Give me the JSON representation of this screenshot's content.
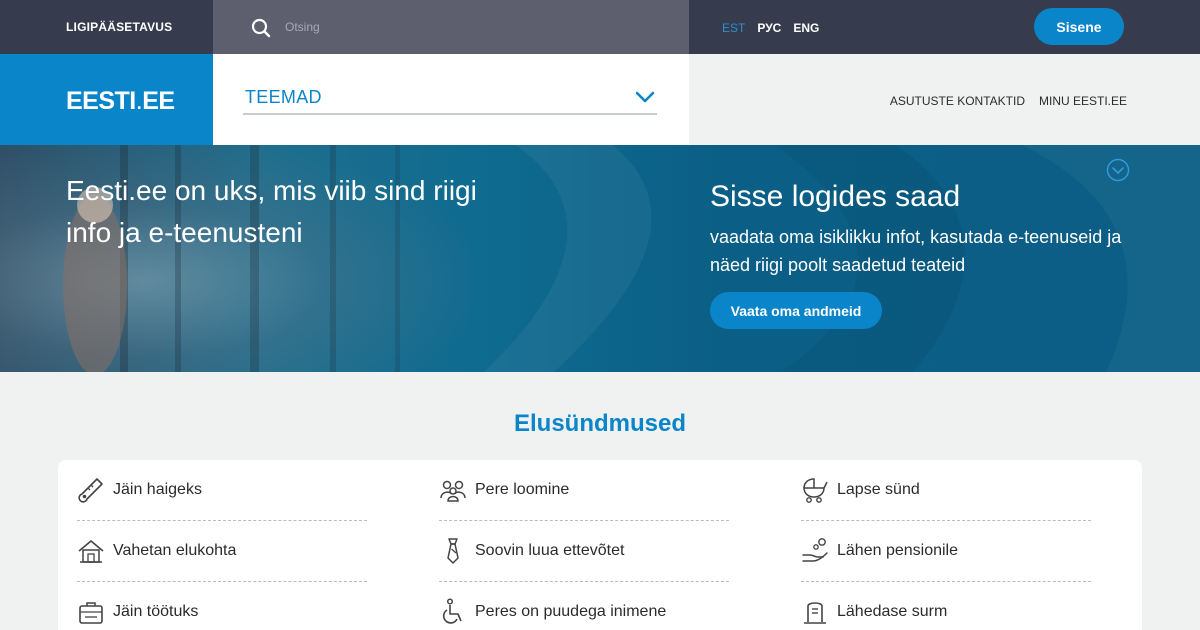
{
  "topbar": {
    "accessibility": "LIGIPÄÄSETAVUS",
    "search_placeholder": "Otsing",
    "languages": [
      {
        "code": "EST",
        "active": true
      },
      {
        "code": "РУС",
        "active": false
      },
      {
        "code": "ENG",
        "active": false
      }
    ],
    "login_label": "Sisene"
  },
  "header": {
    "logo_main": "EESTI",
    "logo_dot": ".",
    "logo_tail": "EE",
    "topics_label": "TEEMAD",
    "links": [
      "ASUTUSTE KONTAKTID",
      "MINU EESTI.EE"
    ]
  },
  "hero": {
    "left_text": "Eesti.ee on uks, mis viib sind riigi info ja e-teenusteni",
    "right_title": "Sisse logides saad",
    "right_text": "vaadata oma isiklikku infot, kasutada e-teenuseid ja näed riigi poolt saadetud teateid",
    "button_label": "Vaata oma andmeid"
  },
  "events": {
    "title": "Elusündmused",
    "items": [
      {
        "label": "Jäin haigeks",
        "icon": "thermometer-icon"
      },
      {
        "label": "Pere loomine",
        "icon": "family-icon"
      },
      {
        "label": "Lapse sünd",
        "icon": "baby-carriage-icon"
      },
      {
        "label": "Vahetan elukohta",
        "icon": "house-icon"
      },
      {
        "label": "Soovin luua ettevõtet",
        "icon": "necktie-icon"
      },
      {
        "label": "Lähen pensionile",
        "icon": "pension-hand-icon"
      },
      {
        "label": "Jäin töötuks",
        "icon": "briefcase-icon"
      },
      {
        "label": "Peres on puudega inimene",
        "icon": "wheelchair-icon"
      },
      {
        "label": "Lähedase surm",
        "icon": "gravestone-icon"
      }
    ]
  },
  "colors": {
    "topbar_bg": "#373b4e",
    "brand_blue": "#0a85c9",
    "page_bg": "#f0f2f2"
  }
}
